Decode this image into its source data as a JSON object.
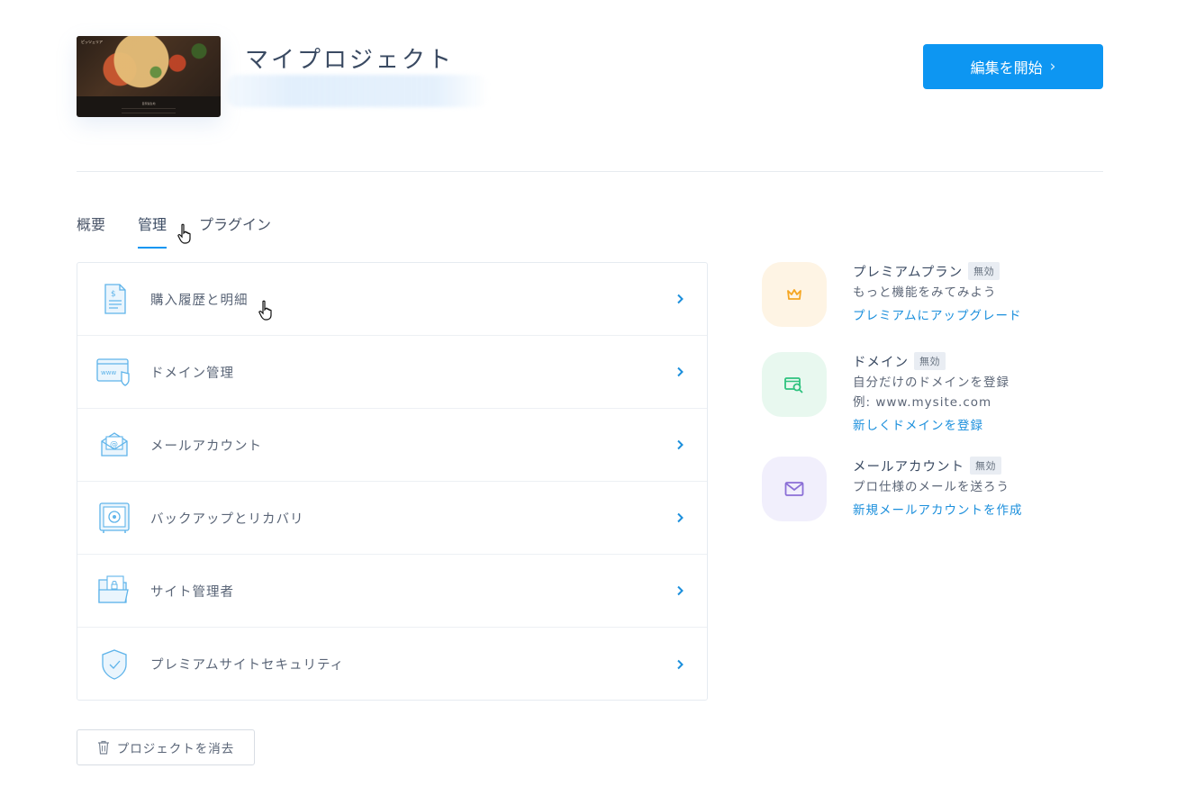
{
  "header": {
    "project_title": "マイプロジェクト",
    "edit_button": "編集を開始",
    "thumbnail": {
      "tag": "ピッツェリア",
      "caption": "自家製生地"
    }
  },
  "tabs": [
    {
      "label": "概要",
      "active": false
    },
    {
      "label": "管理",
      "active": true
    },
    {
      "label": "プラグイン",
      "active": false
    }
  ],
  "management": {
    "items": [
      {
        "label": "購入履歴と明細",
        "icon": "receipt-icon"
      },
      {
        "label": "ドメイン管理",
        "icon": "domain-www-icon"
      },
      {
        "label": "メールアカウント",
        "icon": "email-envelope-icon"
      },
      {
        "label": "バックアップとリカバリ",
        "icon": "safe-icon"
      },
      {
        "label": "サイト管理者",
        "icon": "folder-lock-icon"
      },
      {
        "label": "プレミアムサイトセキュリティ",
        "icon": "shield-check-icon"
      }
    ]
  },
  "features": [
    {
      "name": "プレミアムプラン",
      "status": "無効",
      "desc": [
        "もっと機能をみてみよう"
      ],
      "link": "プレミアムにアップグレード",
      "icon": "crown-icon",
      "icon_color": "#f5a623",
      "bg_color": "#fef4e4"
    },
    {
      "name": "ドメイン",
      "status": "無効",
      "desc": [
        "自分だけのドメインを登録",
        "例: www.mysite.com"
      ],
      "link": "新しくドメインを登録",
      "icon": "domain-search-icon",
      "icon_color": "#2ec27e",
      "bg_color": "#e8f8ef"
    },
    {
      "name": "メールアカウント",
      "status": "無効",
      "desc": [
        "プロ仕様のメールを送ろう"
      ],
      "link": "新規メールアカウントを作成",
      "icon": "mail-icon",
      "icon_color": "#8b6fd6",
      "bg_color": "#f1effc"
    }
  ],
  "delete_button": "プロジェクトを消去",
  "colors": {
    "accent": "#0d96f2",
    "link": "#1b8fdc"
  }
}
